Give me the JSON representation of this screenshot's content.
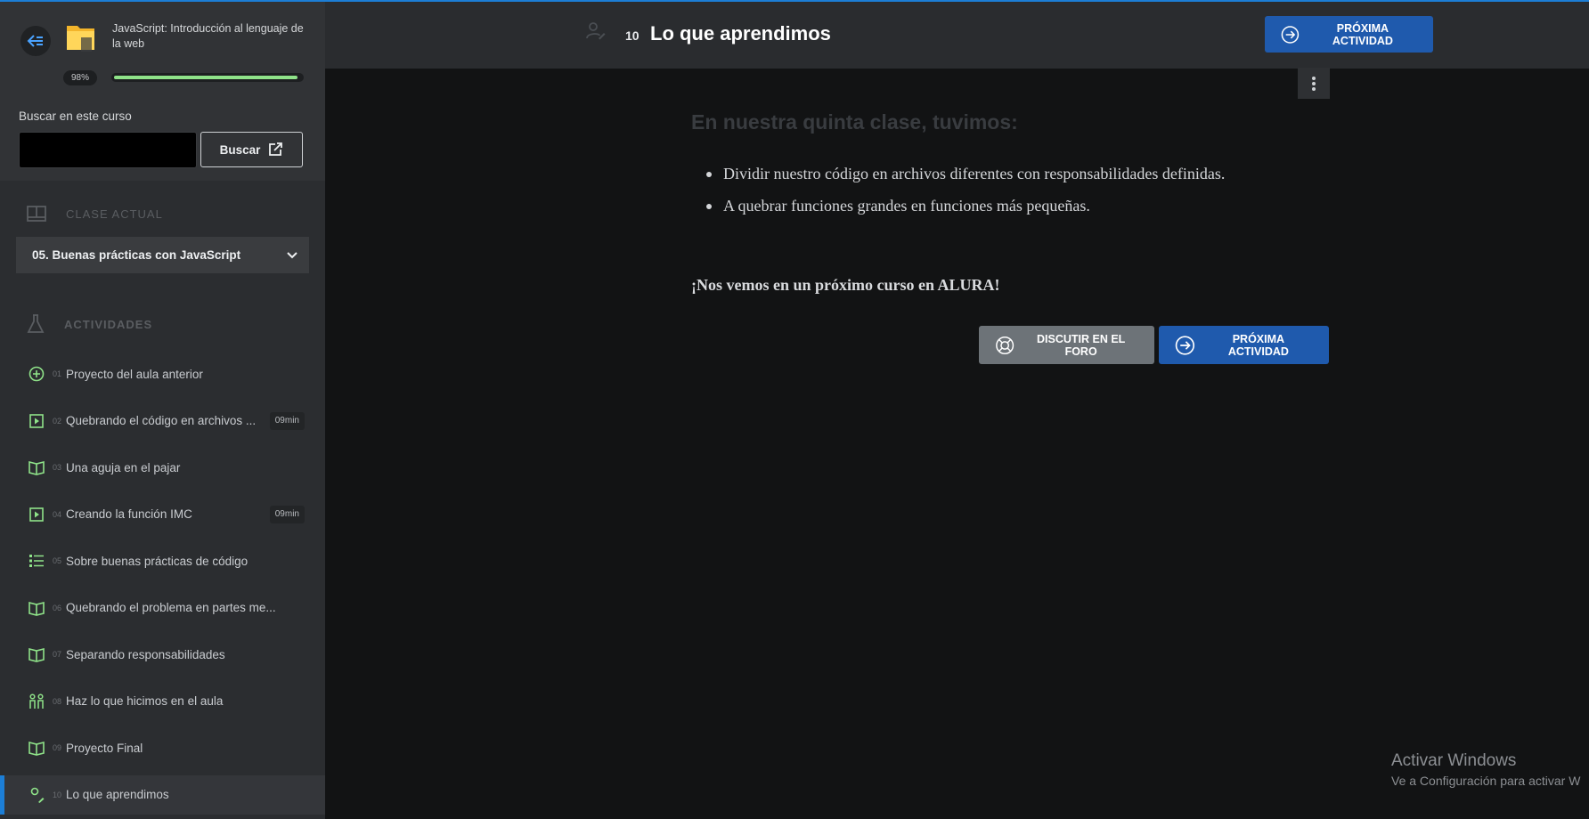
{
  "sidebar": {
    "course_title": "JavaScript: Introducción al lenguaje de la web",
    "progress_label": "98%",
    "progress": 0.98,
    "search": {
      "label": "Buscar en este curso",
      "placeholder": "",
      "value": "",
      "button": "Buscar"
    },
    "current_class": {
      "heading": "CLASE ACTUAL",
      "module": "05. Buenas prácticas con JavaScript"
    },
    "activities": {
      "heading": "ACTIVIDADES",
      "items": [
        {
          "num": "01",
          "label": "Proyecto del aula anterior",
          "icon": "plus-circle-icon",
          "duration": ""
        },
        {
          "num": "02",
          "label": "Quebrando el código en archivos ...",
          "icon": "video-icon",
          "duration": "09min"
        },
        {
          "num": "03",
          "label": "Una aguja en el pajar",
          "icon": "book-icon",
          "duration": ""
        },
        {
          "num": "04",
          "label": "Creando la función IMC",
          "icon": "video-icon",
          "duration": "09min"
        },
        {
          "num": "05",
          "label": "Sobre buenas prácticas de código",
          "icon": "list-icon",
          "duration": ""
        },
        {
          "num": "06",
          "label": "Quebrando el problema en partes me...",
          "icon": "book-icon",
          "duration": ""
        },
        {
          "num": "07",
          "label": "Separando responsabilidades",
          "icon": "book-icon",
          "duration": ""
        },
        {
          "num": "08",
          "label": "Haz lo que hicimos en el aula",
          "icon": "people-icon",
          "duration": ""
        },
        {
          "num": "09",
          "label": "Proyecto Final",
          "icon": "book-icon",
          "duration": ""
        },
        {
          "num": "10",
          "label": "Lo que aprendimos",
          "icon": "user-edit-icon",
          "duration": "",
          "active": true
        }
      ]
    }
  },
  "header": {
    "number": "10",
    "title": "Lo que aprendimos",
    "next_button": "PRÓXIMA ACTIVIDAD"
  },
  "content": {
    "heading": "En nuestra quinta clase, tuvimos:",
    "bullets": [
      "Dividir nuestro código en archivos diferentes con responsabilidades definidas.",
      "A quebrar funciones grandes en funciones más pequeñas."
    ],
    "farewell": "¡Nos vemos en un próximo curso en ALURA!",
    "forum_button": "DISCUTIR EN EL FORO",
    "next_button": "PRÓXIMA ACTIVIDAD"
  },
  "watermark": {
    "line1": "Activar Windows",
    "line2": "Ve a Configuración para activar W"
  },
  "colors": {
    "accent": "#1f5aad",
    "progress": "#8fe389",
    "icon_green": "#8fe389"
  }
}
